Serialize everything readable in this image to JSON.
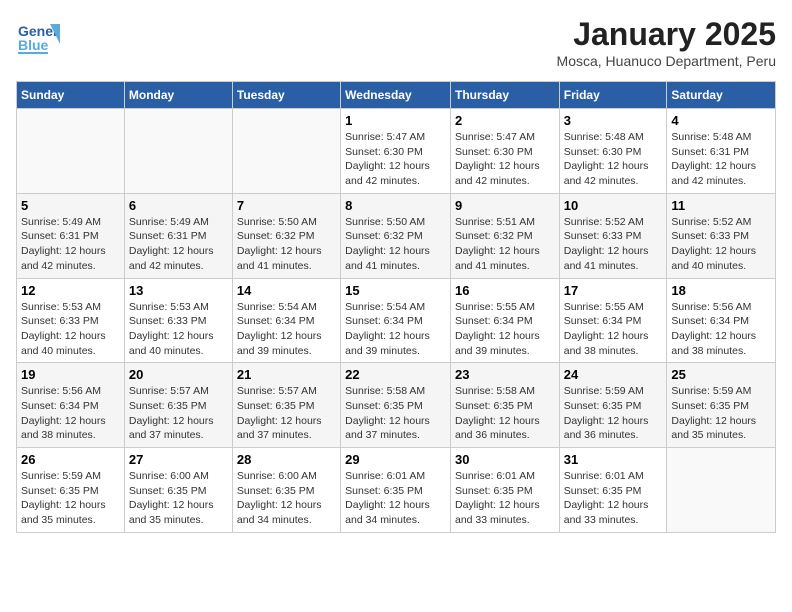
{
  "header": {
    "logo_general": "General",
    "logo_blue": "Blue",
    "title": "January 2025",
    "subtitle": "Mosca, Huanuco Department, Peru"
  },
  "days_of_week": [
    "Sunday",
    "Monday",
    "Tuesday",
    "Wednesday",
    "Thursday",
    "Friday",
    "Saturday"
  ],
  "weeks": [
    {
      "days": [
        {
          "num": "",
          "info": ""
        },
        {
          "num": "",
          "info": ""
        },
        {
          "num": "",
          "info": ""
        },
        {
          "num": "1",
          "info": "Sunrise: 5:47 AM\nSunset: 6:30 PM\nDaylight: 12 hours\nand 42 minutes."
        },
        {
          "num": "2",
          "info": "Sunrise: 5:47 AM\nSunset: 6:30 PM\nDaylight: 12 hours\nand 42 minutes."
        },
        {
          "num": "3",
          "info": "Sunrise: 5:48 AM\nSunset: 6:30 PM\nDaylight: 12 hours\nand 42 minutes."
        },
        {
          "num": "4",
          "info": "Sunrise: 5:48 AM\nSunset: 6:31 PM\nDaylight: 12 hours\nand 42 minutes."
        }
      ]
    },
    {
      "days": [
        {
          "num": "5",
          "info": "Sunrise: 5:49 AM\nSunset: 6:31 PM\nDaylight: 12 hours\nand 42 minutes."
        },
        {
          "num": "6",
          "info": "Sunrise: 5:49 AM\nSunset: 6:31 PM\nDaylight: 12 hours\nand 42 minutes."
        },
        {
          "num": "7",
          "info": "Sunrise: 5:50 AM\nSunset: 6:32 PM\nDaylight: 12 hours\nand 41 minutes."
        },
        {
          "num": "8",
          "info": "Sunrise: 5:50 AM\nSunset: 6:32 PM\nDaylight: 12 hours\nand 41 minutes."
        },
        {
          "num": "9",
          "info": "Sunrise: 5:51 AM\nSunset: 6:32 PM\nDaylight: 12 hours\nand 41 minutes."
        },
        {
          "num": "10",
          "info": "Sunrise: 5:52 AM\nSunset: 6:33 PM\nDaylight: 12 hours\nand 41 minutes."
        },
        {
          "num": "11",
          "info": "Sunrise: 5:52 AM\nSunset: 6:33 PM\nDaylight: 12 hours\nand 40 minutes."
        }
      ]
    },
    {
      "days": [
        {
          "num": "12",
          "info": "Sunrise: 5:53 AM\nSunset: 6:33 PM\nDaylight: 12 hours\nand 40 minutes."
        },
        {
          "num": "13",
          "info": "Sunrise: 5:53 AM\nSunset: 6:33 PM\nDaylight: 12 hours\nand 40 minutes."
        },
        {
          "num": "14",
          "info": "Sunrise: 5:54 AM\nSunset: 6:34 PM\nDaylight: 12 hours\nand 39 minutes."
        },
        {
          "num": "15",
          "info": "Sunrise: 5:54 AM\nSunset: 6:34 PM\nDaylight: 12 hours\nand 39 minutes."
        },
        {
          "num": "16",
          "info": "Sunrise: 5:55 AM\nSunset: 6:34 PM\nDaylight: 12 hours\nand 39 minutes."
        },
        {
          "num": "17",
          "info": "Sunrise: 5:55 AM\nSunset: 6:34 PM\nDaylight: 12 hours\nand 38 minutes."
        },
        {
          "num": "18",
          "info": "Sunrise: 5:56 AM\nSunset: 6:34 PM\nDaylight: 12 hours\nand 38 minutes."
        }
      ]
    },
    {
      "days": [
        {
          "num": "19",
          "info": "Sunrise: 5:56 AM\nSunset: 6:34 PM\nDaylight: 12 hours\nand 38 minutes."
        },
        {
          "num": "20",
          "info": "Sunrise: 5:57 AM\nSunset: 6:35 PM\nDaylight: 12 hours\nand 37 minutes."
        },
        {
          "num": "21",
          "info": "Sunrise: 5:57 AM\nSunset: 6:35 PM\nDaylight: 12 hours\nand 37 minutes."
        },
        {
          "num": "22",
          "info": "Sunrise: 5:58 AM\nSunset: 6:35 PM\nDaylight: 12 hours\nand 37 minutes."
        },
        {
          "num": "23",
          "info": "Sunrise: 5:58 AM\nSunset: 6:35 PM\nDaylight: 12 hours\nand 36 minutes."
        },
        {
          "num": "24",
          "info": "Sunrise: 5:59 AM\nSunset: 6:35 PM\nDaylight: 12 hours\nand 36 minutes."
        },
        {
          "num": "25",
          "info": "Sunrise: 5:59 AM\nSunset: 6:35 PM\nDaylight: 12 hours\nand 35 minutes."
        }
      ]
    },
    {
      "days": [
        {
          "num": "26",
          "info": "Sunrise: 5:59 AM\nSunset: 6:35 PM\nDaylight: 12 hours\nand 35 minutes."
        },
        {
          "num": "27",
          "info": "Sunrise: 6:00 AM\nSunset: 6:35 PM\nDaylight: 12 hours\nand 35 minutes."
        },
        {
          "num": "28",
          "info": "Sunrise: 6:00 AM\nSunset: 6:35 PM\nDaylight: 12 hours\nand 34 minutes."
        },
        {
          "num": "29",
          "info": "Sunrise: 6:01 AM\nSunset: 6:35 PM\nDaylight: 12 hours\nand 34 minutes."
        },
        {
          "num": "30",
          "info": "Sunrise: 6:01 AM\nSunset: 6:35 PM\nDaylight: 12 hours\nand 33 minutes."
        },
        {
          "num": "31",
          "info": "Sunrise: 6:01 AM\nSunset: 6:35 PM\nDaylight: 12 hours\nand 33 minutes."
        },
        {
          "num": "",
          "info": ""
        }
      ]
    }
  ]
}
